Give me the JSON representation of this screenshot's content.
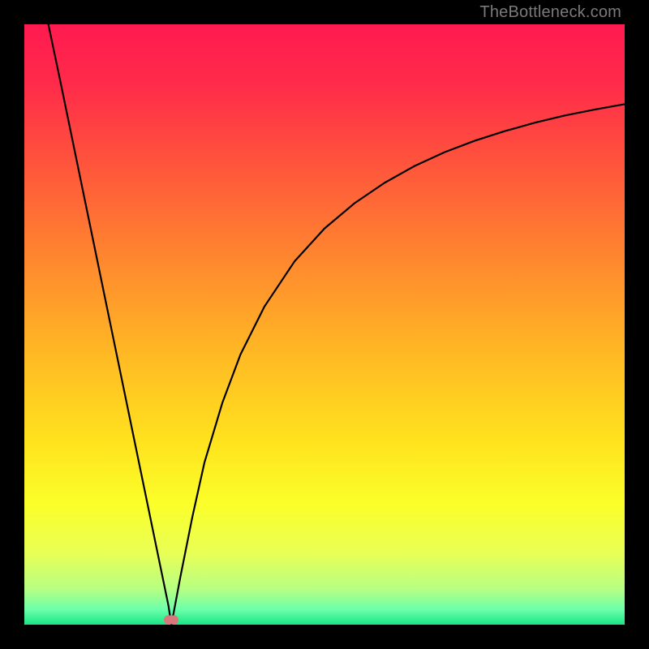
{
  "watermark": "TheBottleneck.com",
  "marker": {
    "x_pct": 24.5,
    "y_pct": 99.2
  },
  "colors": {
    "gradient_stops": [
      {
        "offset": 0.0,
        "color": "#ff1a50"
      },
      {
        "offset": 0.1,
        "color": "#ff2b4a"
      },
      {
        "offset": 0.25,
        "color": "#ff5a3a"
      },
      {
        "offset": 0.4,
        "color": "#ff8a2e"
      },
      {
        "offset": 0.55,
        "color": "#ffb924"
      },
      {
        "offset": 0.7,
        "color": "#ffe41e"
      },
      {
        "offset": 0.8,
        "color": "#fbff2a"
      },
      {
        "offset": 0.88,
        "color": "#e9ff55"
      },
      {
        "offset": 0.94,
        "color": "#b8ff82"
      },
      {
        "offset": 0.975,
        "color": "#6cffab"
      },
      {
        "offset": 1.0,
        "color": "#19e684"
      }
    ],
    "curve_stroke": "#000000",
    "marker_fill": "#d9777a",
    "frame_bg": "#000000"
  },
  "chart_data": {
    "type": "line",
    "title": "",
    "xlabel": "",
    "ylabel": "",
    "xlim": [
      0,
      100
    ],
    "ylim": [
      0,
      100
    ],
    "grid": false,
    "legend": false,
    "series": [
      {
        "name": "left-descent",
        "x": [
          4,
          6,
          8,
          10,
          12,
          14,
          16,
          18,
          20,
          22,
          24,
          24.5
        ],
        "y": [
          100,
          90.5,
          80.8,
          71.1,
          61.4,
          51.7,
          42.0,
          32.3,
          22.6,
          12.9,
          3.2,
          0
        ]
      },
      {
        "name": "right-ascent",
        "x": [
          24.5,
          26,
          28,
          30,
          33,
          36,
          40,
          45,
          50,
          55,
          60,
          65,
          70,
          75,
          80,
          85,
          90,
          95,
          100
        ],
        "y": [
          0,
          8,
          18,
          27,
          37,
          45,
          53,
          60.5,
          66,
          70.2,
          73.6,
          76.4,
          78.7,
          80.6,
          82.2,
          83.6,
          84.8,
          85.8,
          86.7
        ]
      }
    ],
    "marker_point": {
      "x": 24.5,
      "y": 0.8
    },
    "notes": "V-shaped bottleneck curve. Axis labels and ticks are not shown in the source image; x and y expressed as 0–100 percent of plot area. y=0 is the bottom (green) edge, y=100 is the top (red) edge."
  }
}
